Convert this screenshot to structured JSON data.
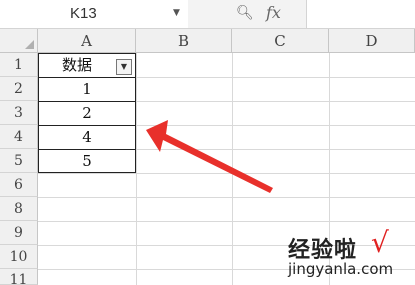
{
  "formula_bar": {
    "name_box": "K13",
    "name_box_dropdown_icon": "chevron-down-icon",
    "zoom_icon": "magnifier-icon",
    "function_icon": "fx",
    "formula": ""
  },
  "columns": [
    "A",
    "B",
    "C",
    "D"
  ],
  "rows": [
    "1",
    "2",
    "3",
    "4",
    "5",
    "6",
    "8",
    "9",
    "10",
    "11"
  ],
  "table": {
    "header": "数据",
    "values": [
      "1",
      "2",
      "4",
      "5"
    ],
    "filter_icon": "filter-dropdown-icon"
  },
  "annotation": {
    "color": "#e8302b"
  },
  "watermark": {
    "title": "经验啦",
    "check": "√",
    "url": "jingyanla.com"
  }
}
